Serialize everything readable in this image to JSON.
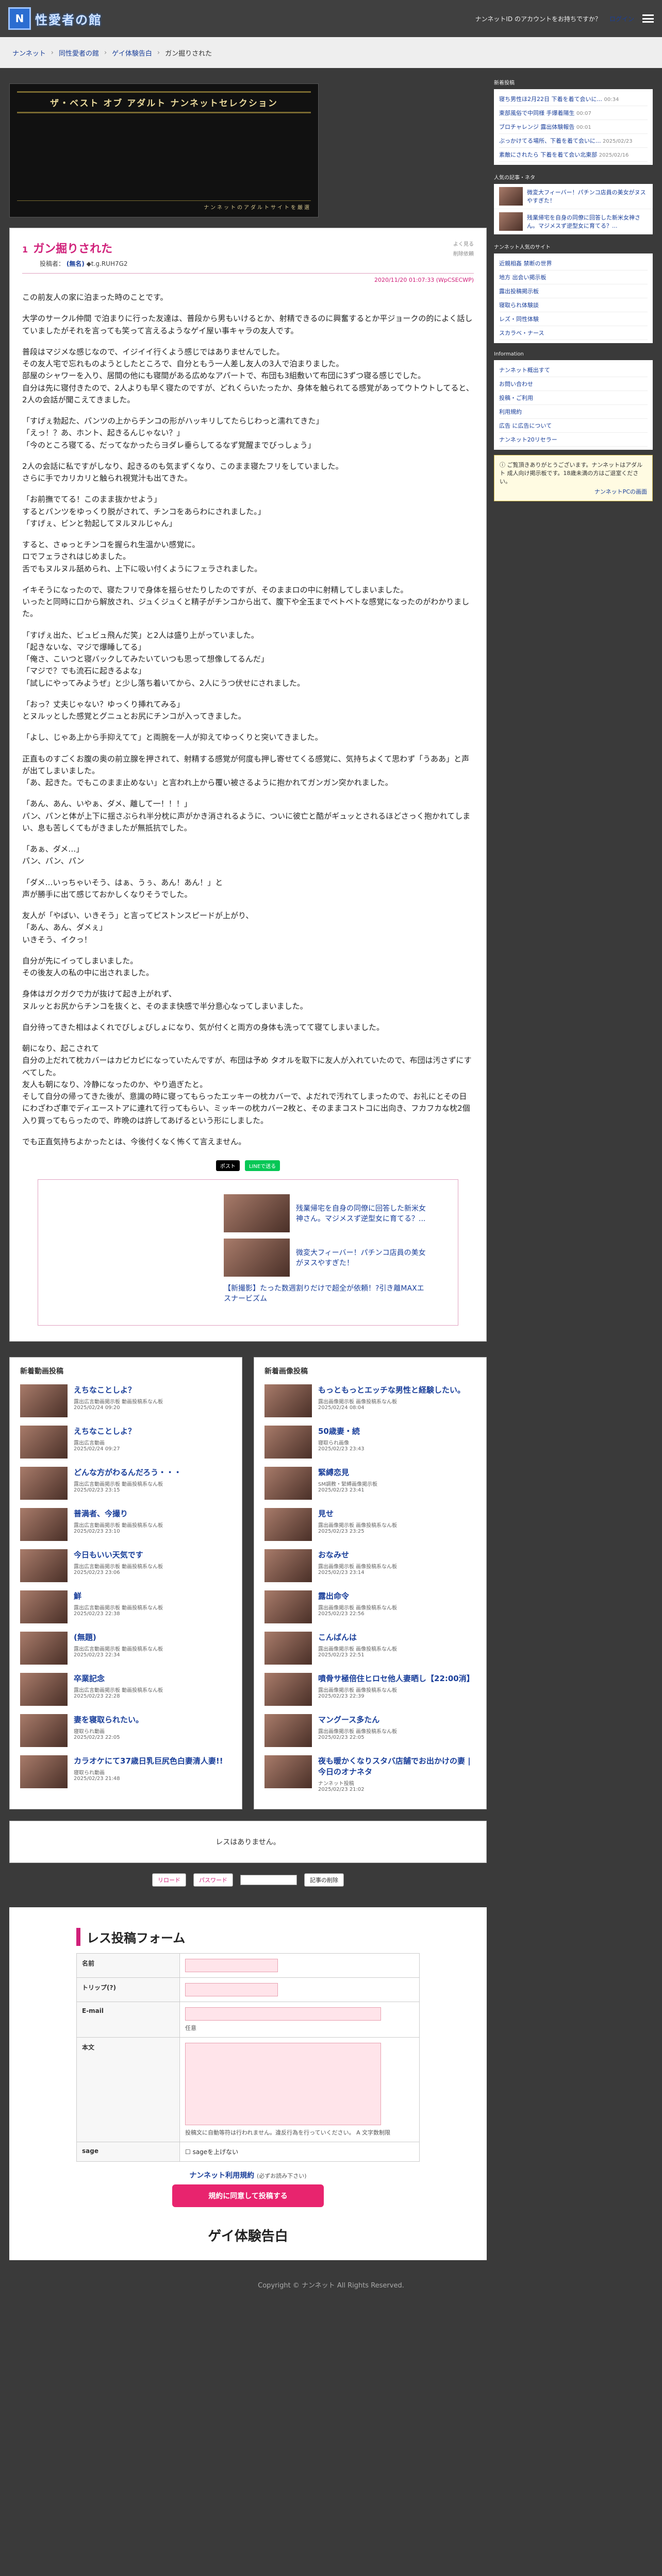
{
  "header": {
    "site_title": "性愛者の館",
    "account_note": "ナンネットID のアカウントをお持ちですか？",
    "login": "ログイン"
  },
  "breadcrumb": [
    "ナンネット",
    "同性愛者の館",
    "ゲイ体験告白",
    "ガン掘りされた"
  ],
  "banner": {
    "title": "ザ・ベスト オブ アダルト ナンネットセレクション",
    "foot": "ナンネットのアダルトサイトを厳選"
  },
  "article": {
    "num": "1",
    "title": "ガン掘りされた",
    "poster_label": "投稿者：",
    "poster": "(無名)",
    "poster_id": "◆t.g.RUH7G2",
    "tools": [
      "よく見る",
      "削除依頼"
    ],
    "date": "2020/11/20 01:07:33 (WpCSECWP)",
    "paragraphs": [
      "この前友人の家に泊まった時のことです。",
      "大学のサークル仲間 で泊まりに行った友達は、普段から男もいけるとか、射精できるのに興奮するとか平ジョークの的によく話していましたがそれを言っても笑って言えるようなゲイ屋い事キャラの友人です。",
      "普段はマジメな感じなので、イジイイ行くよう感じではありませんでした。\nその友人宅で忘れものようとしたところで、自分ともう一人差し友人の3人で泊まりました。\n部屋のシャワーを入り、居間の他にも寝間がある広めなアパートで、布団も3組敷いて布団に3ずつ寝る感じでした。\n自分は先に寝付きたので、2人よりも早く寝たのですが、どれくらいたったか、身体を触られてる感覚があってウトウトしてると、2人の会話が聞こえてきました。",
      "「すげぇ勃起た、パンツの上からチンコの形がハッキリしてたらじわっと濡れてきた」\n「えっ！？あ、ホント、起きるんじゃない？」\n「今のところ寝てる、だってなかったらヨダレ垂らしてるなず覚醒までびっしょう」",
      "2人の会話に私ですがしなり、起きるのも気まずくなり、このまま寝たフリをしていました。\nさらに手でカリカリと触られ視覚汁も出てきた。",
      "「お前撫でてる！このまま抜かせよう」\nするとパンツをゆっくり脱がされて、チンコをあらわにされました。」\n「すげぇ、ビンと勃起してヌルヌルじゃん」",
      "すると、さゅっとチンコを握られ生温かい感覚に。\nロでフェラされはじめました。\n舌でもヌルヌル舐められ、上下に吸い付くようにフェラされました。",
      "イキそうになったので、寝たフリで身体を揺らせたりしたのですが、そのままロの中に射精してしまいました。\nいったと同時に口から解放され、ジュくジュくと精子がチンコから出て、腹下や全玉までベトベトな感覚になったのがわかりました。",
      "「すげぇ出た、ビュビュ飛んだ笑」と2人は盛り上がっていました。\n「起きないな、マジで爆睡してる」\n「俺さ、こいつと寝バックしてみたいていつも思って想像してるんだ」\n「マジで？でも流石に起きるよな」\n「試しにやってみようぜ」と少し落ち着いてから、2人にうつ伏せにされました。",
      "「おっ？丈夫じゃない？ゆっくり挿れてみる」\nとヌルッとした感覚とグニュとお尻にチンコが入ってきました。",
      "「よし、じゃあ上から手抑えてて」と両腕を一人が抑えてゆっくりと突いてきました。",
      "正直ものすごくお腹の奥の前立腺を押されて、射精する感覚が何度も押し寄せてくる感覚に、気持ちよくて思わず「うああ」と声が出てしまいました。\n「あ、起きた。でもこのまま止めない」と言われ上から覆い被さるように抱かれてガンガン突かれました。",
      "「あん、あん、いやぁ、ダメ、離して一！！！」\nパン、パンと体が上下に揺さぶられ半分枕に声がかき消されるように、ついに彼亡と酷がギュッとされるほどさっく抱かれてしまい、息も苦しくてもがきましたが無抵抗でした。",
      "「あぁ、ダメ…」\nパン、パン、パン",
      "「ダメ…いっちゃいそう、はぁ、うぅ、あん！あん！」と\n声が勝手に出て感じておかしくなりそうでした。",
      "友人が「やばい、いきそう」と言ってピストンスピードが上がり、\n「あん、あん、ダメぇ」\nいきそう、イクっ！",
      "自分が先にイってしまいました。\nその後友人の私の中に出されました。",
      "身体はガクガクで力が抜けて起き上がれず、\nヌルッとお尻からチンコを抜くと、そのまま快感で半分意心なってしまいました。",
      "自分待ってきた相はよくれでびしょびしょになり、気が付くと両方の身体も洗ってて寝てしまいました。",
      "朝になり、起こされて\n自分の上だれて枕カバーはカピカピになっていたんですが、布団は予め タオルを取下に友人が入れていたので、布団は汚さずにすべてした。\n友人も朝になり、冷静になったのか、やり過ぎたと。\nそして自分の帰ってきた後が、意識の時に寝ってもらったエッキーの枕カバーで、よだれで汚れてしまったので、お礼にとその日にわざわざ車でディエーストアに連れて行ってもらい、ミッキーの枕カバー2枚と、そのままコストコに出向き、フカフカな枕2個入り買ってもらったので、昨晩のは許してあげるという形にしました。",
      "でも正直気持ちよかったとは、今後付くなく怖くて言えません。"
    ],
    "share": {
      "x": "ポスト",
      "line": "LINEで送る"
    }
  },
  "related": [
    "残業帰宅を自身の同僚に回答した新米女神さん。マジメスず逆型女に育てる？...",
    "微変大フィーバー！パチンコ店員の美女がヌスやすぎた！",
    "【新撮影】たった数週割りだけで超全が依頼！?引き離MAXエスナービズム"
  ],
  "new_video": {
    "title": "新着動画投稿",
    "items": [
      {
        "t": "えちなことしよ？",
        "cat": "露出広言動画掲示板 動画投稿系なん板",
        "d": "2025/02/24 09:20"
      },
      {
        "t": "えちなことしよ？",
        "cat": "露出広言動画",
        "d": "2025/02/24 09:27"
      },
      {
        "t": "どんな方がわるんだろう・・・",
        "cat": "露出広言動画掲示板 動画投稿系なん板",
        "d": "2025/02/23 23:15"
      },
      {
        "t": "普満者、今撮り",
        "cat": "露出広言動画掲示板 動画投稿系なん板",
        "d": "2025/02/23 23:10"
      },
      {
        "t": "今日もいい天気です",
        "cat": "露出広言動画掲示板 動画投稿系なん板",
        "d": "2025/02/23 23:06"
      },
      {
        "t": "鮮",
        "cat": "露出広言動画掲示板 動画投稿系なん板",
        "d": "2025/02/23 22:38"
      },
      {
        "t": "(無題)",
        "cat": "露出広言動画掲示板 動画投稿系なん板",
        "d": "2025/02/23 22:34"
      },
      {
        "t": "卒業記念",
        "cat": "露出広言動画掲示板 動画投稿系なん板",
        "d": "2025/02/23 22:28"
      },
      {
        "t": "妻を寝取られたい。",
        "cat": "寝取られ動画",
        "d": "2025/02/23 22:05"
      },
      {
        "t": "カラオケにて37歳日乳巨尻色白妻清人妻!!",
        "cat": "寝取られ動画",
        "d": "2025/02/23 21:48"
      }
    ]
  },
  "new_image": {
    "title": "新着画像投稿",
    "items": [
      {
        "t": "もっともっとエッチな男性と経験したい。",
        "cat": "露出画像掲示板 画像投稿系なん板",
        "d": "2025/02/24 08:04"
      },
      {
        "t": "50歳妻・続",
        "cat": "寝取られ画像",
        "d": "2025/02/23 23:43"
      },
      {
        "t": "緊縛恋見",
        "cat": "SM調教・緊縛画像掲示板",
        "d": "2025/02/23 23:41"
      },
      {
        "t": "見せ",
        "cat": "露出画像掲示板 画像投稿系なん板",
        "d": "2025/02/23 23:25"
      },
      {
        "t": "おなみせ",
        "cat": "露出画像掲示板 画像投稿系なん板",
        "d": "2025/02/23 23:14"
      },
      {
        "t": "露出命令",
        "cat": "露出画像掲示板 画像投稿系なん板",
        "d": "2025/02/23 22:56"
      },
      {
        "t": "こんばんは",
        "cat": "露出画像掲示板 画像投稿系なん板",
        "d": "2025/02/23 22:51"
      },
      {
        "t": "噴骨サ極倍住ヒロセ他人妻晒し【22:00消】",
        "cat": "露出画像掲示板 画像投稿系なん板",
        "d": "2025/02/23 22:39"
      },
      {
        "t": "マングース多たん",
        "cat": "露出画像掲示板 画像投稿系なん板",
        "d": "2025/02/23 22:05"
      },
      {
        "t": "夜も暖かくなりスタバ店舗でお出かけの妻 | 今日のオナネタ",
        "cat": "ナンネット投稿",
        "d": "2025/02/23 21:02"
      }
    ]
  },
  "nores": "レスはありません。",
  "paging": {
    "reload": "リロード",
    "password": "パスワード",
    "delete": "記事の削除"
  },
  "form": {
    "title": "レス投稿フォーム",
    "rows": [
      "名前",
      "トリップ(?)",
      "E-mail",
      "本文",
      "sage"
    ],
    "email_note": "任意",
    "body_note": "投稿文に自動等符は行われません。違反行為を行っていください。 A 文字数制限",
    "sage_note": "sageを上げない",
    "terms": "ナンネット利用規約",
    "terms_note": "(必ずお読み下さい)",
    "submit": "規約に同意して投稿する",
    "footer_title": "ゲイ体験告白"
  },
  "sidebar": {
    "new_title": "新着投稿",
    "new_items": [
      {
        "t": "寝ち男性ほ2月22日 下着を着て会いに...",
        "d": "00:34"
      },
      {
        "t": "東部風俗で中同様 手爆着陽生",
        "d": "00:07"
      },
      {
        "t": "ブロチャレンジ 露出体験報告",
        "d": "00:01"
      },
      {
        "t": "ぶっかけてる場所、下着を着て会いに...",
        "d": "2025/02/23"
      },
      {
        "t": "素敵にされたら 下着を着て会い北東部",
        "d": "2025/02/16"
      }
    ],
    "rank_title": "人気の記事・ネタ",
    "rank": [
      "微変大フィーバー！パチンコ店員の美女がヌスやすぎた！",
      "残業帰宅を自身の同僚に回答した新米女神さん。マジメスず逆型女に育てる？..."
    ],
    "nav_title": "ナンネット人気のサイト",
    "nav": [
      "近親相姦 禁断の世界",
      "地方 出会い掲示板",
      "露出投稿掲示板",
      "寝取られ体験談",
      "レズ・同性体験",
      "スカラベ・ナース"
    ],
    "info_title": "Information",
    "info": [
      "ナンネット概出すて",
      "お問い合わせ",
      "投稿・ご利用",
      "利用規約",
      "広告 に広告について",
      "ナンネット20リセラー"
    ],
    "notice": "ご覧頂きありがとうございます。ナンネットはアダルト 成人向け掲示板です。18歳未満の方はご退室ください。",
    "notice_link": "ナンネットPCの画面"
  },
  "footer": "Copyright © ナンネット All Rights Reserved."
}
